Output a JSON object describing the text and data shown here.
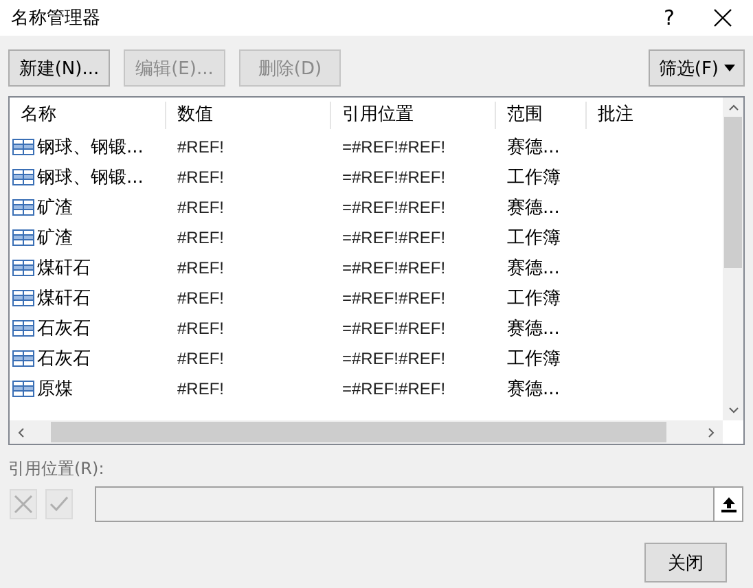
{
  "window": {
    "title": "名称管理器",
    "help": "?"
  },
  "toolbar": {
    "buttons": [
      {
        "label": "新建(N)...",
        "disabled": false
      },
      {
        "label": "编辑(E)...",
        "disabled": true
      },
      {
        "label": "删除(D)",
        "disabled": true
      }
    ],
    "filter": "筛选(F)"
  },
  "table": {
    "columns": [
      "名称",
      "数值",
      "引用位置",
      "范围",
      "批注"
    ],
    "rows": [
      {
        "name": "钢球、钢锻...",
        "value": "#REF!",
        "ref": "=#REF!#REF!",
        "scope": "赛德..."
      },
      {
        "name": "钢球、钢锻...",
        "value": "#REF!",
        "ref": "=#REF!#REF!",
        "scope": "工作簿"
      },
      {
        "name": "矿渣",
        "value": "#REF!",
        "ref": "=#REF!#REF!",
        "scope": "赛德..."
      },
      {
        "name": "矿渣",
        "value": "#REF!",
        "ref": "=#REF!#REF!",
        "scope": "工作簿"
      },
      {
        "name": "煤矸石",
        "value": "#REF!",
        "ref": "=#REF!#REF!",
        "scope": "赛德..."
      },
      {
        "name": "煤矸石",
        "value": "#REF!",
        "ref": "=#REF!#REF!",
        "scope": "工作簿"
      },
      {
        "name": "石灰石",
        "value": "#REF!",
        "ref": "=#REF!#REF!",
        "scope": "赛德..."
      },
      {
        "name": "石灰石",
        "value": "#REF!",
        "ref": "=#REF!#REF!",
        "scope": "工作簿"
      },
      {
        "name": "原煤",
        "value": "#REF!",
        "ref": "=#REF!#REF!",
        "scope": "赛德..."
      }
    ]
  },
  "reference": {
    "label": "引用位置(R):",
    "disabled": true
  },
  "close_button": "关闭"
}
